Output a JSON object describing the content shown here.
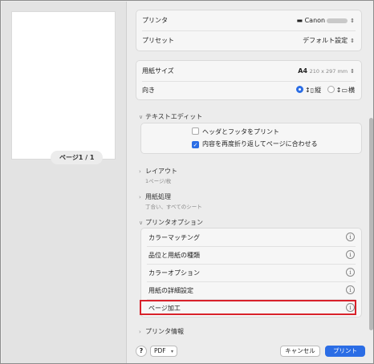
{
  "preview": {
    "page_indicator": "ページ1 / 1"
  },
  "printer": {
    "label": "プリンタ",
    "value": "Canon"
  },
  "preset": {
    "label": "プリセット",
    "value": "デフォルト設定"
  },
  "paper_size": {
    "label": "用紙サイズ",
    "value": "A4",
    "dims": "210 x 297 mm"
  },
  "orientation": {
    "label": "向き",
    "portrait": "縦",
    "landscape": "横",
    "selected": "portrait"
  },
  "text_edit": {
    "header": "テキストエディット",
    "option1": "ヘッダとフッタをプリント",
    "option1_checked": false,
    "option2": "内容を再度折り返してページに合わせる",
    "option2_checked": true
  },
  "layout": {
    "header": "レイアウト",
    "summary": "1ページ/枚"
  },
  "paper_handling": {
    "header": "用紙処理",
    "summary": "丁合い、すべてのシート"
  },
  "printer_options": {
    "header": "プリンタオプション",
    "items": [
      {
        "label": "カラーマッチング"
      },
      {
        "label": "品位と用紙の種類"
      },
      {
        "label": "カラーオプション"
      },
      {
        "label": "用紙の詳細設定"
      },
      {
        "label": "ページ加工"
      }
    ],
    "highlighted_index": 4
  },
  "printer_info": {
    "header": "プリンタ情報"
  },
  "footer": {
    "help": "?",
    "pdf": "PDF",
    "cancel": "キャンセル",
    "print": "プリント"
  },
  "colors": {
    "accent": "#2b6de5",
    "highlight": "#d8212a"
  }
}
